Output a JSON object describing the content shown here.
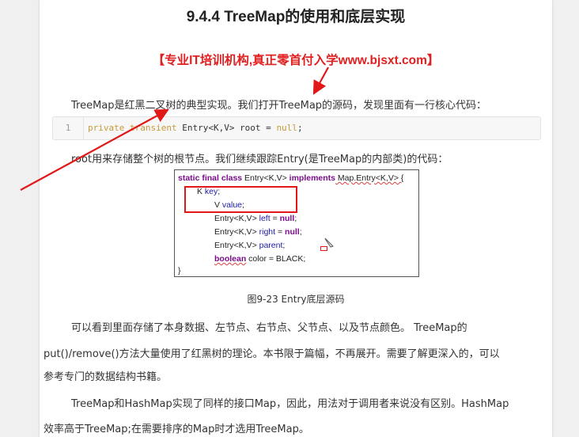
{
  "heading": "9.4.4 TreeMap的使用和底层实现",
  "promo": "【专业IT培训机构,真正零首付入学www.bjsxt.com】",
  "intro": "TreeMap是红黑二叉树的典型实现。我们打开TreeMap的源码，发现里面有一行核心代码：",
  "code_snippet": {
    "line_number": "1",
    "keywords": "private transient",
    "rest": " Entry<K,V> root = ",
    "value": "null",
    "end": ";"
  },
  "root_note": "root用来存储整个树的根节点。我们继续跟踪Entry(是TreeMap的内部类)的代码：",
  "figure_lines": {
    "l1_kw": "static final class",
    "l1_a": " Entry<K,V> ",
    "l1_kw2": "implements",
    "l1_b": " Map.Entry<K,V> {",
    "l2_a": "K ",
    "l2_id": "key",
    "l2_b": ";",
    "l3_a": "V ",
    "l3_id": "value",
    "l3_b": ";",
    "l4_a": "Entry<K,V> ",
    "l4_id": "left",
    "l4_b": " = ",
    "l4_kw": "null",
    "l4_c": ";",
    "l5_a": "Entry<K,V> ",
    "l5_id": "right",
    "l5_b": " = ",
    "l5_kw": "null",
    "l5_c": ";",
    "l6_a": "Entry<K,V> ",
    "l6_id": "parent",
    "l6_b": ";",
    "l7_kw": "boolean",
    "l7_a": " color = BLACK;",
    "l8": "}"
  },
  "caption": "图9-23 Entry底层源码",
  "para3_line1": "可以看到里面存储了本身数据、左节点、右节点、父节点、以及节点颜色。 TreeMap的",
  "para3_line2": "put()/remove()方法大量使用了红黑树的理论。本书限于篇幅，不再展开。需要了解更深入的，可以",
  "para3_line3": "参考专门的数据结构书籍。",
  "para4_line1": "TreeMap和HashMap实现了同样的接口Map，因此，用法对于调用者来说没有区别。HashMap",
  "para4_line2": "效率高于TreeMap;在需要排序的Map时才选用TreeMap。",
  "colors": {
    "promo_red": "#e02020",
    "annotation_red": "#e01818",
    "code_keyword": "#c79a3a"
  }
}
